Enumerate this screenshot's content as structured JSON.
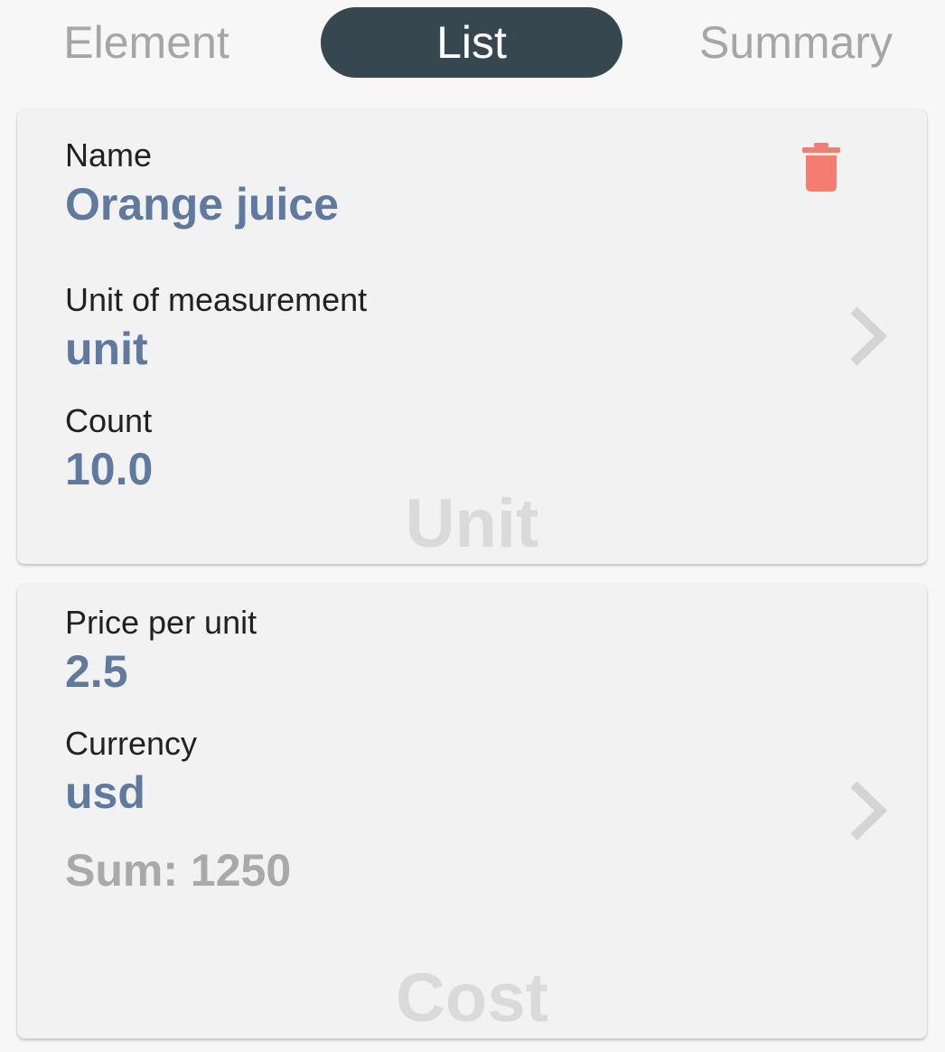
{
  "tabs": {
    "element": "Element",
    "list": "List",
    "summary": "Summary"
  },
  "unit_card": {
    "name_label": "Name",
    "name_value": "Orange juice",
    "unit_label": "Unit of measurement",
    "unit_value": "unit",
    "count_label": "Count",
    "count_value": "10.0",
    "watermark": "Unit"
  },
  "cost_card": {
    "price_label": "Price per unit",
    "price_value": "2.5",
    "currency_label": "Currency",
    "currency_value": "usd",
    "sum_text": "Sum: 1250",
    "watermark": "Cost"
  },
  "icons": {
    "delete": "trash-icon",
    "navigate": "chevron-right-icon"
  },
  "colors": {
    "active_tab": "#37474f",
    "value_text": "#60799f",
    "delete_icon": "#f47c70",
    "inactive_tab": "#a6a6a6"
  }
}
